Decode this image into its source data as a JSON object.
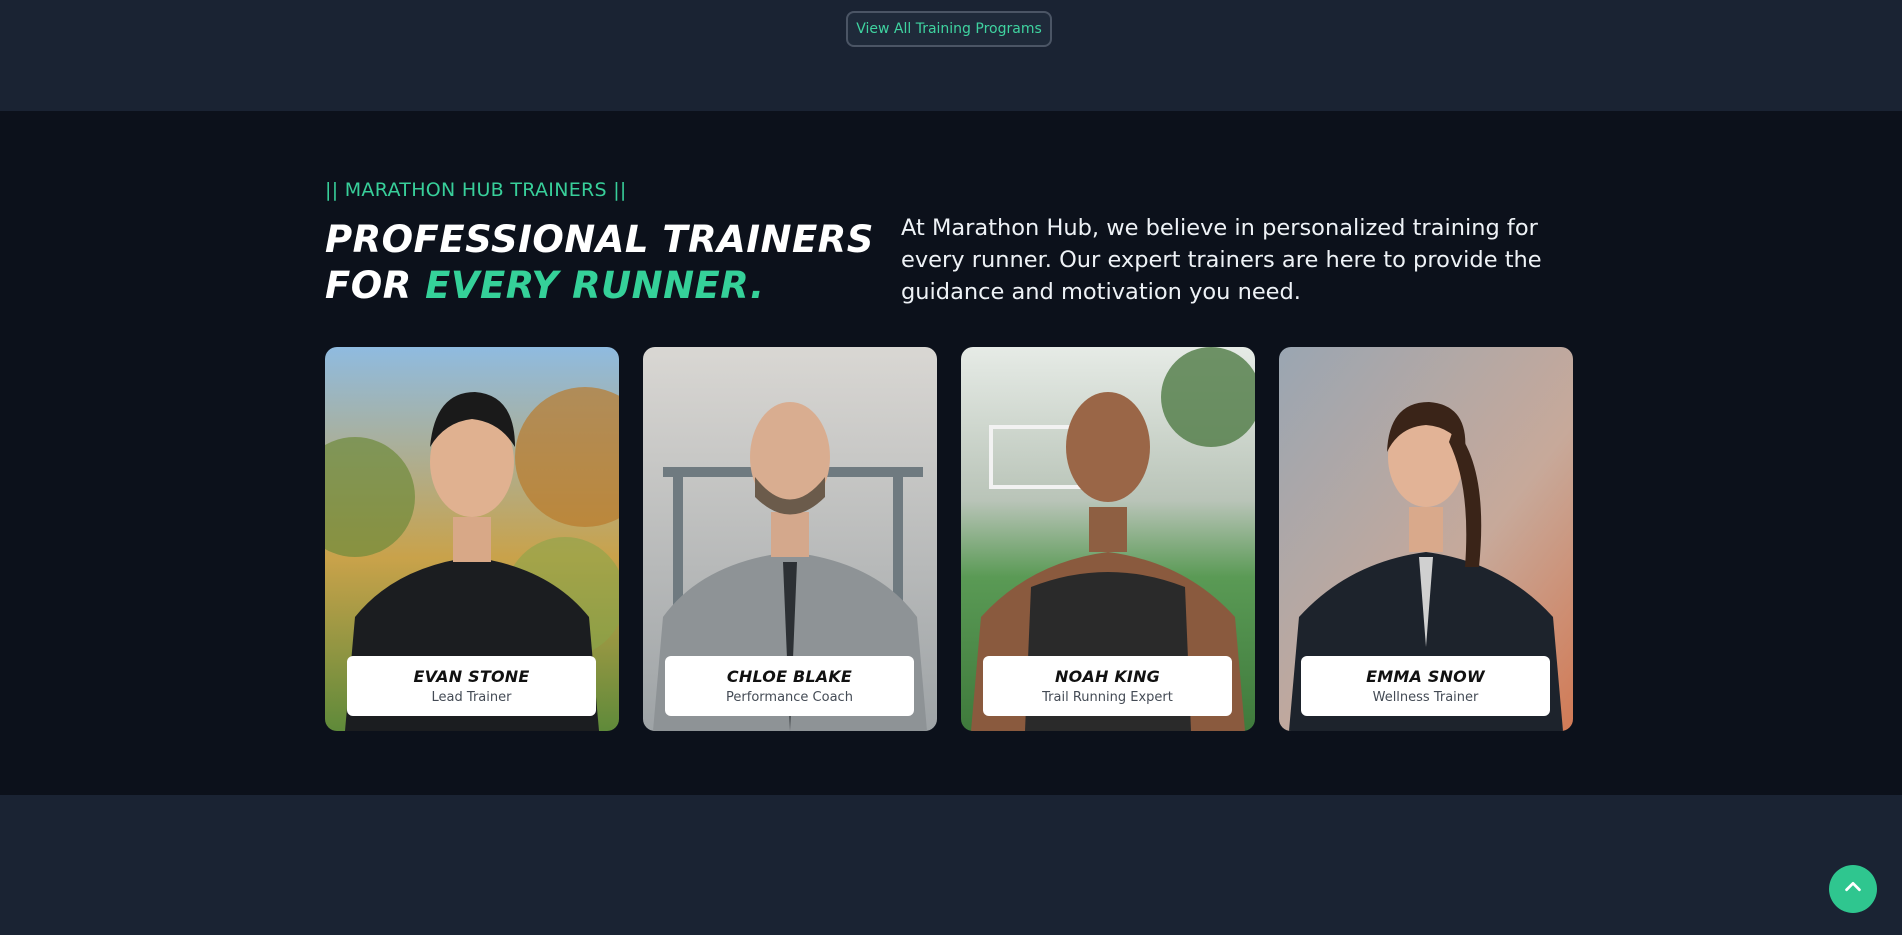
{
  "top": {
    "view_all_label": "View All Training Programs"
  },
  "trainers": {
    "eyebrow": "|| MARATHON HUB TRAINERS ||",
    "heading_line1": "PROFESSIONAL TRAINERS",
    "heading_line2_prefix": "FOR ",
    "heading_line2_accent": "EVERY RUNNER.",
    "intro": "At Marathon Hub, we believe in personalized training for every runner. Our expert trainers are here to provide the guidance and motivation you need.",
    "cards": [
      {
        "name": "EVAN STONE",
        "role": "Lead Trainer"
      },
      {
        "name": "CHLOE BLAKE",
        "role": "Performance Coach"
      },
      {
        "name": "NOAH KING",
        "role": "Trail Running Expert"
      },
      {
        "name": "EMMA SNOW",
        "role": "Wellness Trainer"
      }
    ]
  },
  "colors": {
    "accent": "#35d199",
    "dark_bg": "#0c111b",
    "band_bg": "#1a2333"
  },
  "icons": {
    "scroll_top": "chevron-up-icon"
  }
}
